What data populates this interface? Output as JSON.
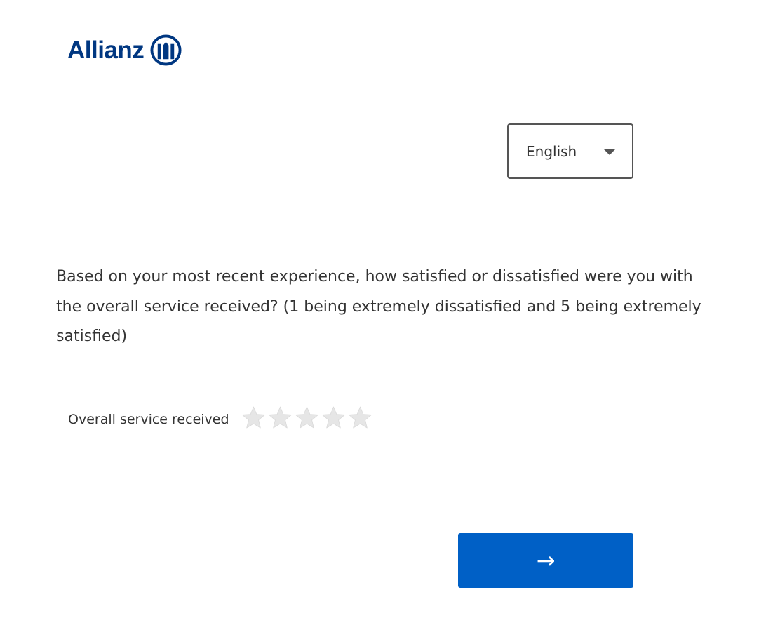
{
  "brand": {
    "name": "Allianz",
    "color": "#003781"
  },
  "language_select": {
    "selected": "English"
  },
  "question": {
    "text": "Based on your most recent experience, how satisfied or dissatisfied were you with the overall service received? (1 being extremely dissatisfied and 5 being extremely satisfied)"
  },
  "rating": {
    "label": "Overall service received",
    "max_stars": 5,
    "selected": 0,
    "star_color": "#e6e6e6"
  },
  "navigation": {
    "next_label": "→",
    "button_color": "#0060c6"
  }
}
